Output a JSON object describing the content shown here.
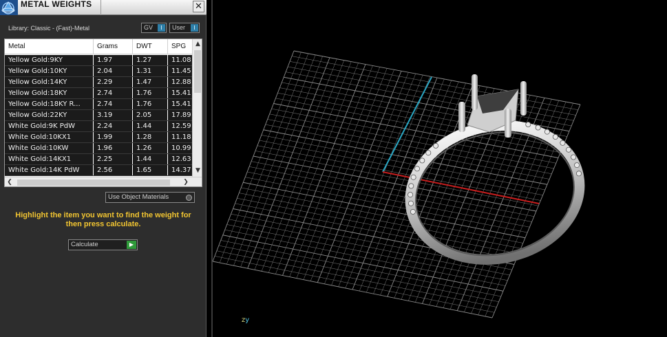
{
  "window": {
    "title": "METAL WEIGHTS",
    "close_label": "✕"
  },
  "library": {
    "label": "Library: Classic - (Fast)-Metal",
    "gv_label": "GV",
    "user_label": "User",
    "toggle_glyph": "I"
  },
  "table": {
    "columns": [
      "Metal",
      "Grams",
      "DWT",
      "SPG"
    ],
    "rows": [
      [
        "Yellow Gold:9KY",
        "1.97",
        "1.27",
        "11.08"
      ],
      [
        "Yellow Gold:10KY",
        "2.04",
        "1.31",
        "11.45"
      ],
      [
        "Yellow Gold:14KY",
        "2.29",
        "1.47",
        "12.88"
      ],
      [
        "Yellow Gold:18KY",
        "2.74",
        "1.76",
        "15.41"
      ],
      [
        "Yellow Gold:18KY R...",
        "2.74",
        "1.76",
        "15.41"
      ],
      [
        "Yellow Gold:22KY",
        "3.19",
        "2.05",
        "17.89"
      ],
      [
        "White Gold:9K PdW",
        "2.24",
        "1.44",
        "12.59"
      ],
      [
        "White Gold:10KX1",
        "1.99",
        "1.28",
        "11.18"
      ],
      [
        "White Gold:10KW",
        "1.96",
        "1.26",
        "10.99"
      ],
      [
        "White Gold:14KX1",
        "2.25",
        "1.44",
        "12.63"
      ],
      [
        "White Gold:14K PdW",
        "2.56",
        "1.65",
        "14.37"
      ]
    ],
    "scroll_up": "▲",
    "scroll_down": "▼",
    "scroll_left": "❮",
    "scroll_right": "❯"
  },
  "options": {
    "use_object_materials": "Use Object Materials"
  },
  "instructions": "Highlight the item you want to find the weight for then press calculate.",
  "calculate": {
    "label": "Calculate",
    "go_glyph": "▶"
  },
  "viewport": {
    "axis_z": "z",
    "axis_y": "y",
    "colors": {
      "grid": "#8c8c8c",
      "x_axis": "#c81e1e",
      "y_axis": "#2aa7c4",
      "ring": "#d2d2d2"
    }
  }
}
